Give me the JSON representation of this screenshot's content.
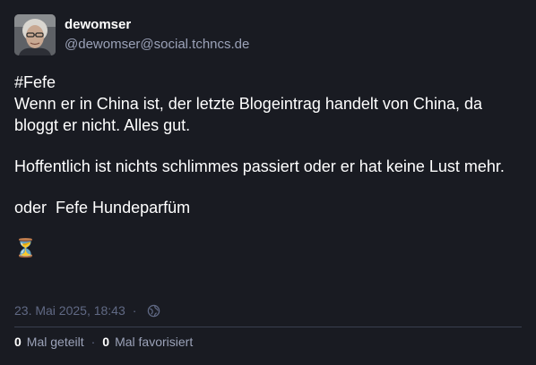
{
  "author": {
    "display_name": "dewomser",
    "handle": "@dewomser@social.tchncs.de",
    "avatar_icon": "user-avatar-photo"
  },
  "content": {
    "hashtag": "#Fefe",
    "line1": "Wenn er in China ist, der letzte Blogeintrag handelt von China, da bloggt er nicht. Alles gut.",
    "paragraph2": "Hoffentlich ist nichts schlimmes passiert oder er hat keine Lust mehr.",
    "paragraph3": "oder  Fefe Hundeparfüm",
    "emoji": "⏳"
  },
  "meta": {
    "timestamp": "23. Mai 2025, 18:43",
    "separator": "·",
    "visibility_icon": "globe-icon"
  },
  "stats": {
    "boost_count": "0",
    "boost_label": "Mal geteilt",
    "separator": "·",
    "favourite_count": "0",
    "favourite_label": "Mal favorisiert"
  },
  "colors": {
    "background": "#191b22",
    "text_primary": "#ffffff",
    "text_secondary": "#9ba2b8",
    "text_muted": "#606984",
    "divider": "#393f4f"
  }
}
